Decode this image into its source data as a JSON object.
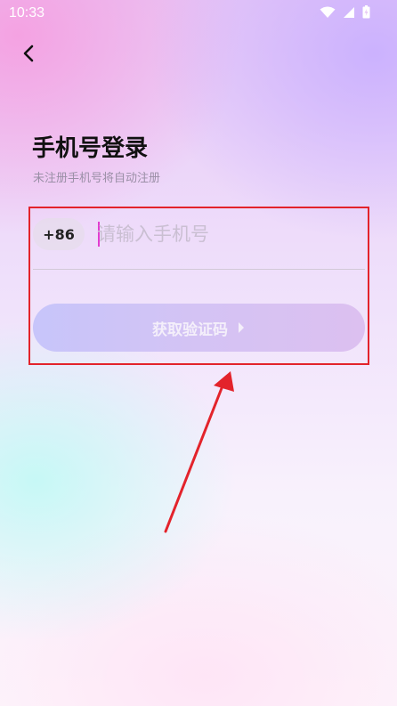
{
  "status_bar": {
    "time": "10:33"
  },
  "header": {
    "back_icon": "chevron-left-icon"
  },
  "login": {
    "title": "手机号登录",
    "subtitle": "未注册手机号将自动注册",
    "country_code": "+86",
    "phone_placeholder": "请输入手机号",
    "phone_value": "",
    "get_code_label": "获取验证码"
  },
  "annotation": {
    "color": "#e3232b"
  }
}
